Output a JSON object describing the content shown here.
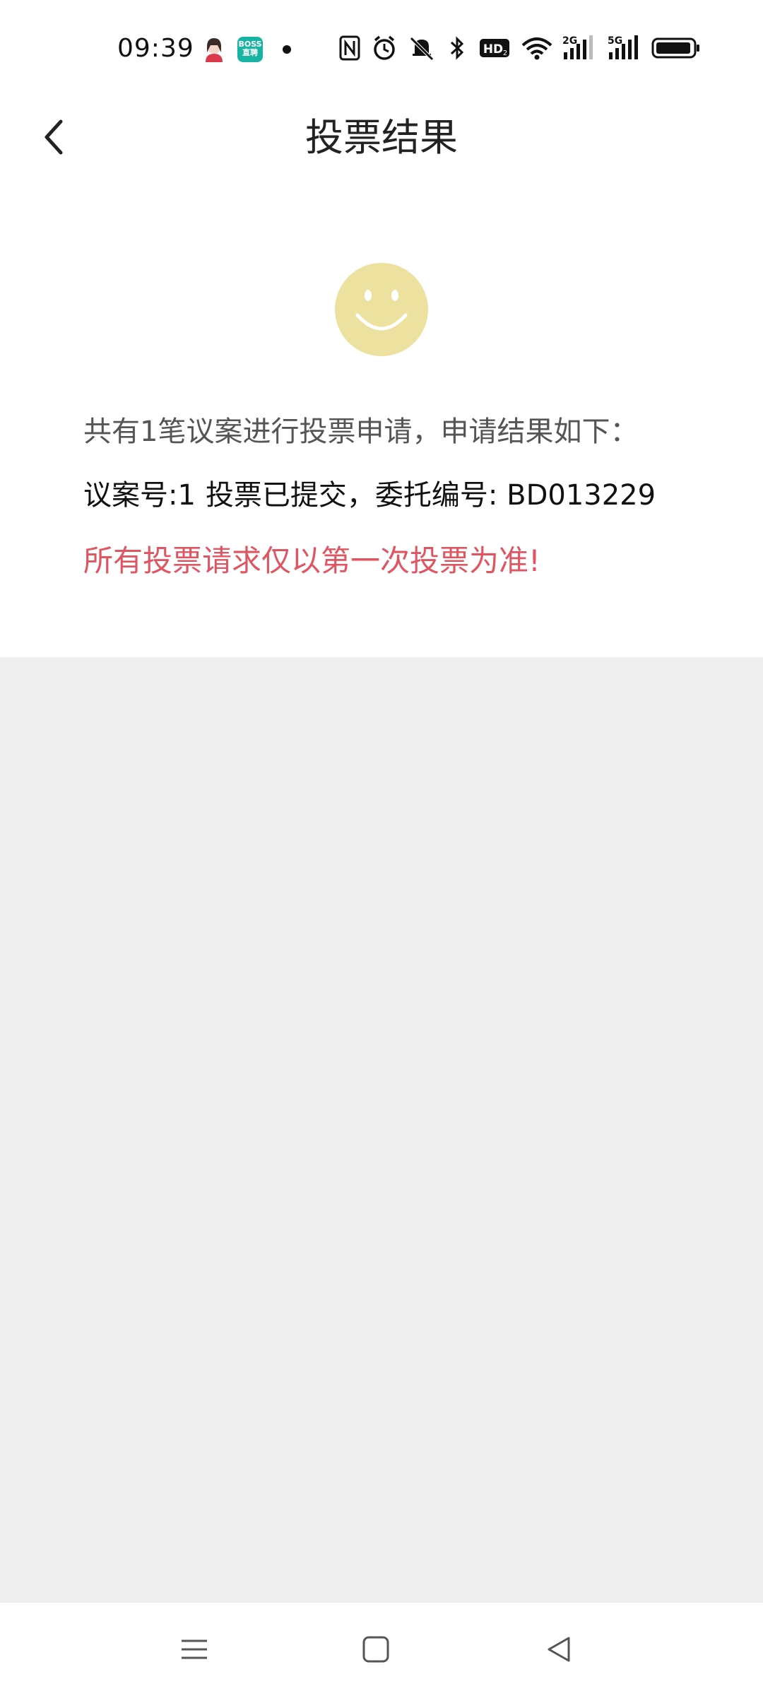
{
  "status_bar": {
    "time": "09:39",
    "boss_app_text": "BOSS\n直聘",
    "network_labels": {
      "hd": "HD2",
      "sim1": "2G",
      "sim2": "5G"
    }
  },
  "header": {
    "title": "投票结果",
    "back_icon": "chevron-left-icon"
  },
  "result": {
    "icon": "smiley-icon",
    "icon_color": "#EDE1A0",
    "summary": "共有1笔议案进行投票申请，申请结果如下：",
    "detail_proposal": "议案号:1",
    "detail_status": "投票已提交，委托编号: BD013229",
    "warning": "所有投票请求仅以第一次投票为准!",
    "warning_color": "#E05562"
  },
  "nav_bar": {
    "menu_icon": "menu-icon",
    "home_icon": "home-square-icon",
    "back_icon": "back-triangle-icon"
  }
}
